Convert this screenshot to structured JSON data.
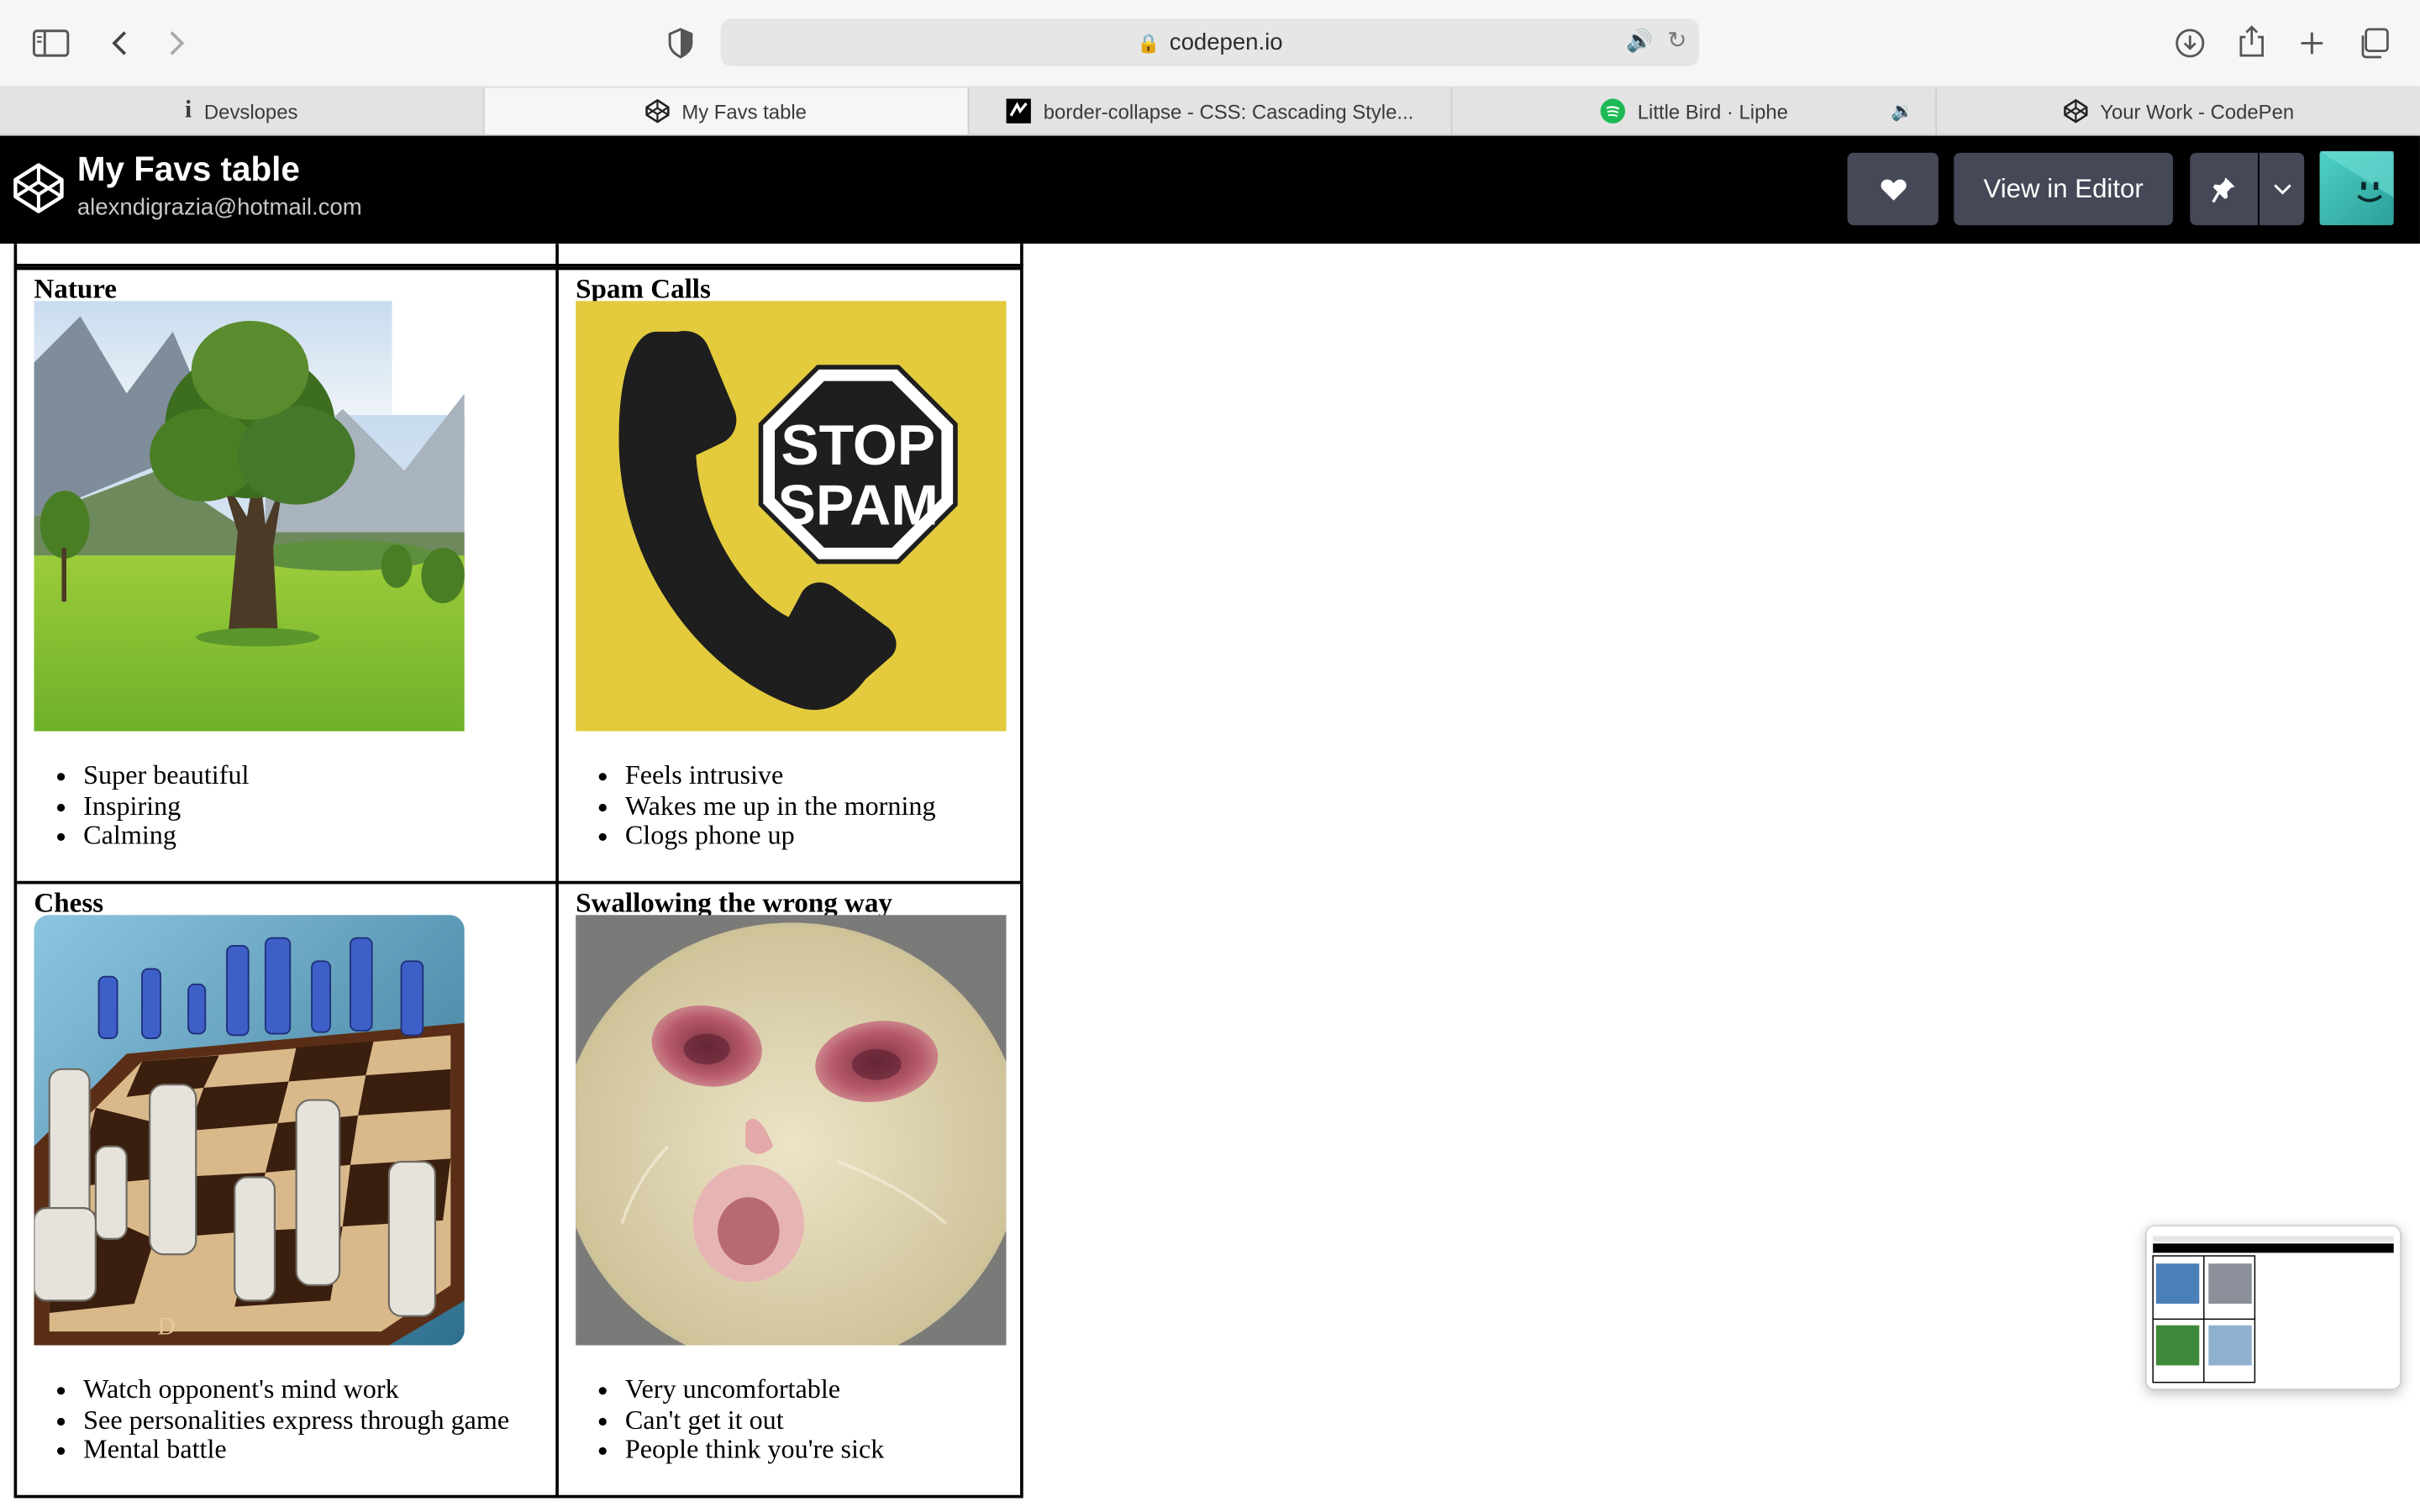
{
  "browser": {
    "url": "codepen.io",
    "tabs": [
      {
        "label": "Devslopes",
        "icon": "info-icon",
        "active": false
      },
      {
        "label": "My Favs table",
        "icon": "codepen-icon",
        "active": true
      },
      {
        "label": "border-collapse - CSS: Cascading Style...",
        "icon": "mdn-icon",
        "active": false
      },
      {
        "label": "Little Bird · Liphe",
        "icon": "spotify-icon",
        "active": false,
        "audio": true
      },
      {
        "label": "Your Work - CodePen",
        "icon": "codepen-icon",
        "active": false
      }
    ]
  },
  "header": {
    "title": "My Favs table",
    "user": "alexndigrazia@hotmail.com",
    "editor_button": "View in Editor"
  },
  "table": {
    "cells": [
      {
        "title": "Nature",
        "image": "tree-in-meadow",
        "items": [
          "Super beautiful",
          "Inspiring",
          "Calming"
        ]
      },
      {
        "title": "Spam Calls",
        "image": "stop-spam-phone",
        "sign_text": [
          "STOP",
          "SPAM"
        ],
        "items": [
          "Feels intrusive",
          "Wakes me up in the morning",
          "Clogs phone up"
        ]
      },
      {
        "title": "Chess",
        "image": "chess-board",
        "board_letter": "D",
        "items": [
          "Watch opponent's mind work",
          "See personalities express through game",
          "Mental battle"
        ]
      },
      {
        "title": "Swallowing the wrong way",
        "image": "crying-cat",
        "items": [
          "Very uncomfortable",
          "Can't get it out",
          "People think you're sick"
        ]
      }
    ]
  },
  "colors": {
    "header_bg": "#000000",
    "button_bg": "#444857",
    "spam_bg": "#e3cb3d"
  }
}
